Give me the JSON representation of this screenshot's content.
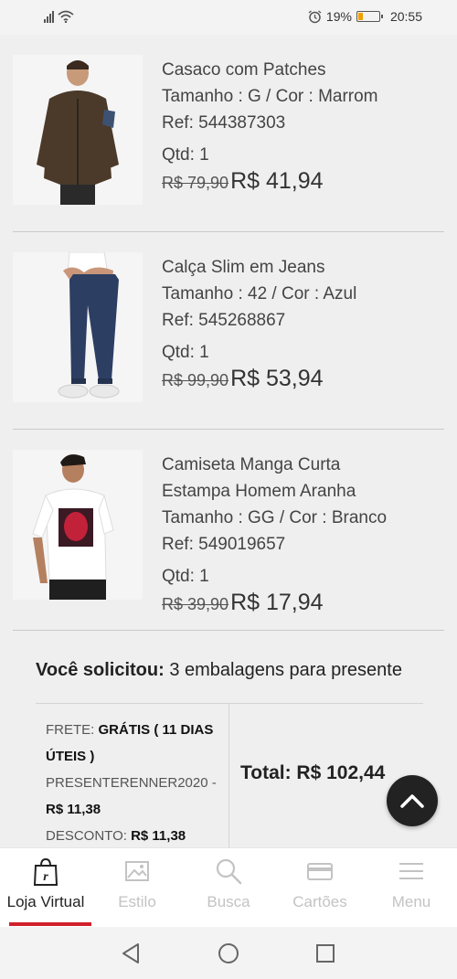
{
  "status": {
    "battery": "19%",
    "time": "20:55"
  },
  "products": [
    {
      "name": "Casaco com Patches",
      "attrs": "Tamanho : G / Cor : Marrom",
      "ref": "Ref: 544387303",
      "qty": "Qtd: 1",
      "old_price": "R$ 79,90",
      "price": "R$ 41,94"
    },
    {
      "name": "Calça Slim em Jeans",
      "attrs": "Tamanho : 42 / Cor : Azul",
      "ref": "Ref: 545268867",
      "qty": "Qtd: 1",
      "old_price": "R$ 99,90",
      "price": "R$ 53,94"
    },
    {
      "name_line1": "Camiseta Manga Curta",
      "name_line2": "Estampa Homem Aranha",
      "attrs": "Tamanho : GG / Cor : Branco",
      "ref": "Ref: 549019657",
      "qty": "Qtd: 1",
      "old_price": "R$ 39,90",
      "price": "R$ 17,94"
    }
  ],
  "gift": {
    "label": "Você solicitou:",
    "text": " 3 embalagens para presente"
  },
  "summary": {
    "frete_label": "FRETE:",
    "frete_value": "GRÁTIS ( 11 DIAS ÚTEIS )",
    "coupon_label": "PRESENTERENNER2020 -",
    "coupon_value": "R$ 11,38",
    "discount_label": "DESCONTO:",
    "discount_value": "R$ 11,38",
    "total": "Total: R$ 102,44"
  },
  "bottom_nav": [
    {
      "label": "Loja Virtual",
      "icon": "shopping-bag-icon",
      "active": true
    },
    {
      "label": "Estilo",
      "icon": "image-icon"
    },
    {
      "label": "Busca",
      "icon": "search-icon"
    },
    {
      "label": "Cartões",
      "icon": "card-icon"
    },
    {
      "label": "Menu",
      "icon": "hamburger-icon"
    }
  ],
  "colors": {
    "accent": "#d0202a",
    "fab": "#222222",
    "battery": "#f0a000"
  }
}
